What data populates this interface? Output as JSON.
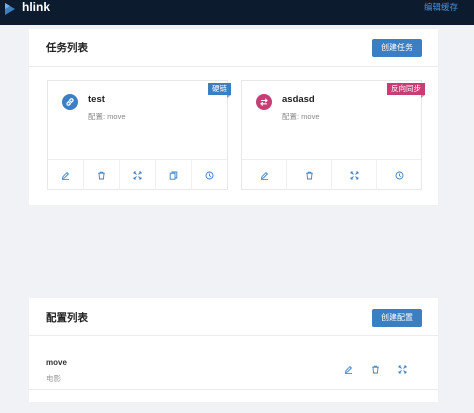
{
  "app": {
    "title": "hlink",
    "header_link": "编辑缓存"
  },
  "colors": {
    "topbar": "#0d1b2e",
    "primary": "#3a7fc1",
    "accent_pink": "#c83d75",
    "icon_blue": "#3d7fc4",
    "action_blue": "#3a7fc1"
  },
  "tasks_panel": {
    "title": "任务列表",
    "create_label": "创建任务",
    "items": [
      {
        "name": "test",
        "config_line": "配置: move",
        "tag": "硬链",
        "tag_color": "#3a7fc1",
        "icon": "link-icon",
        "icon_color": "#3d7fc4",
        "actions": [
          "edit-icon",
          "delete-icon",
          "expand-icon",
          "copy-icon",
          "history-icon"
        ]
      },
      {
        "name": "asdasd",
        "config_line": "配置: move",
        "tag": "反向同步",
        "tag_color": "#c83d75",
        "icon": "sync-icon",
        "icon_color": "#c83d75",
        "actions": [
          "edit-icon",
          "delete-icon",
          "expand-icon",
          "history-icon"
        ]
      }
    ]
  },
  "configs_panel": {
    "title": "配置列表",
    "create_label": "创建配置",
    "items": [
      {
        "name": "move",
        "description": "电影",
        "actions": [
          "edit-icon",
          "delete-icon",
          "expand-icon"
        ]
      }
    ]
  }
}
